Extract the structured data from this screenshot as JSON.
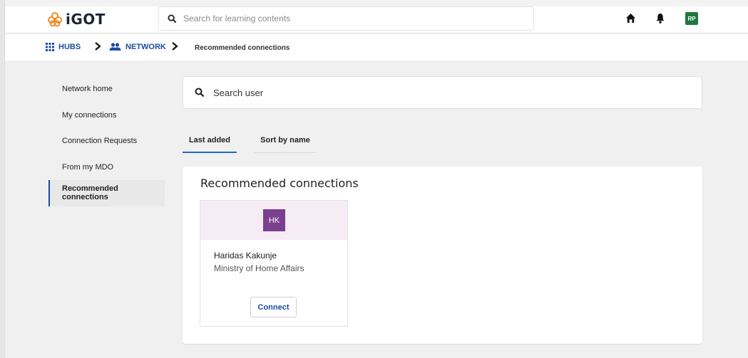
{
  "header": {
    "logo_text": "iGOT",
    "search_placeholder": "Search for learning contents",
    "avatar_initials": "RP"
  },
  "breadcrumb": {
    "hubs": "HUBS",
    "network": "NETWORK",
    "current": "Recommended connections"
  },
  "sidebar": {
    "items": [
      {
        "label": "Network home",
        "active": false
      },
      {
        "label": "My connections",
        "active": false
      },
      {
        "label": "Connection Requests",
        "active": false
      },
      {
        "label": "From my MDO",
        "active": false
      },
      {
        "label": "Recommended connections",
        "active": true
      }
    ]
  },
  "search_user": {
    "placeholder": "Search user"
  },
  "tabs": [
    {
      "label": "Last added",
      "active": true
    },
    {
      "label": "Sort by name",
      "active": false
    }
  ],
  "panel": {
    "title": "Recommended connections",
    "cards": [
      {
        "initials": "HK",
        "name": "Haridas Kakunje",
        "org": "Ministry of Home Affairs",
        "button": "Connect"
      }
    ]
  },
  "colors": {
    "link_blue": "#1b4ca1",
    "avatar_green": "#1c7a3d",
    "card_avatar_purple": "#7b3f8f",
    "card_top_bg": "#f5ecf6"
  }
}
